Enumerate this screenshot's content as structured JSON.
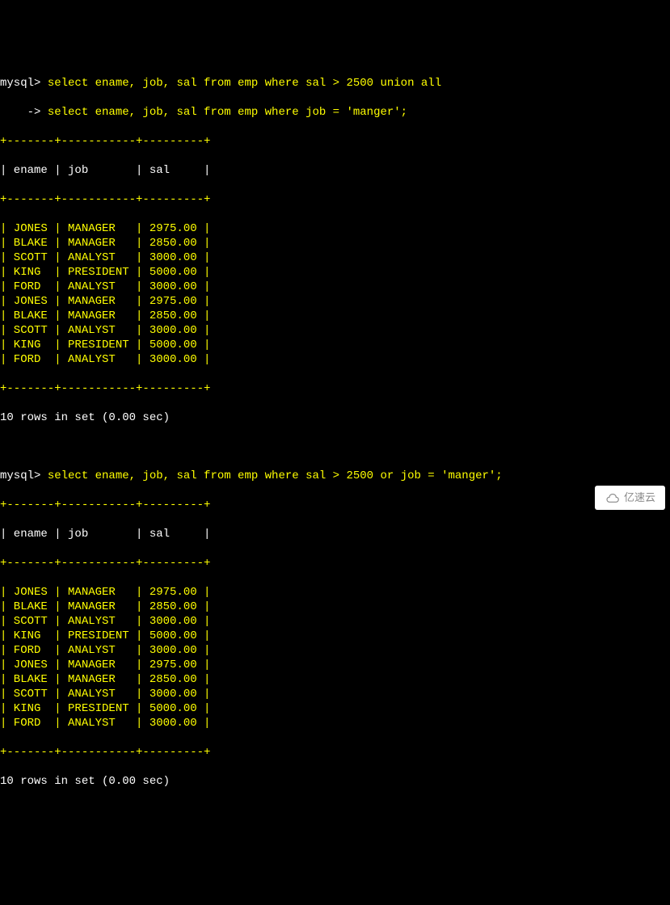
{
  "query1": {
    "prompt1": "mysql> ",
    "line1": "select ename, job, sal from emp where sal > 2500 union all",
    "prompt2": "    -> ",
    "line2": "select ename, job, sal from emp where job = 'manger';"
  },
  "table1": {
    "border": "+-------+-----------+---------+",
    "headers": {
      "col1": "ename",
      "col2": "job",
      "col3": "sal"
    },
    "rows": [
      {
        "ename": "JONES",
        "job": "MANAGER",
        "sal": "2975.00"
      },
      {
        "ename": "BLAKE",
        "job": "MANAGER",
        "sal": "2850.00"
      },
      {
        "ename": "SCOTT",
        "job": "ANALYST",
        "sal": "3000.00"
      },
      {
        "ename": "KING",
        "job": "PRESIDENT",
        "sal": "5000.00"
      },
      {
        "ename": "FORD",
        "job": "ANALYST",
        "sal": "3000.00"
      },
      {
        "ename": "JONES",
        "job": "MANAGER",
        "sal": "2975.00"
      },
      {
        "ename": "BLAKE",
        "job": "MANAGER",
        "sal": "2850.00"
      },
      {
        "ename": "SCOTT",
        "job": "ANALYST",
        "sal": "3000.00"
      },
      {
        "ename": "KING",
        "job": "PRESIDENT",
        "sal": "5000.00"
      },
      {
        "ename": "FORD",
        "job": "ANALYST",
        "sal": "3000.00"
      }
    ],
    "result": "10 rows in set (0.00 sec)"
  },
  "query2": {
    "prompt1": "mysql> ",
    "line1": "select ename, job, sal from emp where sal > 2500 or job = 'manger';"
  },
  "table2": {
    "border": "+-------+-----------+---------+",
    "headers": {
      "col1": "ename",
      "col2": "job",
      "col3": "sal"
    },
    "rows": [
      {
        "ename": "JONES",
        "job": "MANAGER",
        "sal": "2975.00"
      },
      {
        "ename": "BLAKE",
        "job": "MANAGER",
        "sal": "2850.00"
      },
      {
        "ename": "SCOTT",
        "job": "ANALYST",
        "sal": "3000.00"
      },
      {
        "ename": "KING",
        "job": "PRESIDENT",
        "sal": "5000.00"
      },
      {
        "ename": "FORD",
        "job": "ANALYST",
        "sal": "3000.00"
      },
      {
        "ename": "JONES",
        "job": "MANAGER",
        "sal": "2975.00"
      },
      {
        "ename": "BLAKE",
        "job": "MANAGER",
        "sal": "2850.00"
      },
      {
        "ename": "SCOTT",
        "job": "ANALYST",
        "sal": "3000.00"
      },
      {
        "ename": "KING",
        "job": "PRESIDENT",
        "sal": "5000.00"
      },
      {
        "ename": "FORD",
        "job": "ANALYST",
        "sal": "3000.00"
      }
    ],
    "result": "10 rows in set (0.00 sec)"
  },
  "watermark": {
    "text": "亿速云"
  }
}
